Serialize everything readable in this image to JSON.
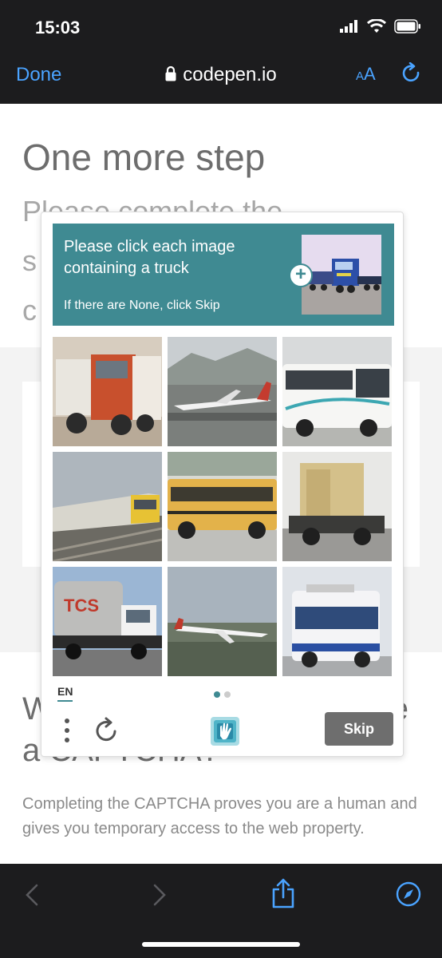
{
  "status_bar": {
    "time": "15:03"
  },
  "browser": {
    "done_label": "Done",
    "url": "codepen.io",
    "reader_label_small": "A",
    "reader_label_big": "A"
  },
  "page": {
    "heading": "One more step",
    "subheading": "Please complete the se... c...",
    "subheading_visible_line1": "Please complete the",
    "subheading_visible_line2_left": "s",
    "subheading_visible_line3_left": "c",
    "why_line1_left": "W",
    "why_line1_right": "e",
    "why_line2": "a CAPTCHA?",
    "description": "Completing the CAPTCHA proves you are a human and gives you temporary access to the web property."
  },
  "captcha": {
    "prompt_title": "Please click each image containing a truck",
    "prompt_sub": "If there are None, click Skip",
    "prompt_plus": "+",
    "language": "EN",
    "skip_label": "Skip",
    "page_indicator": {
      "current": 1,
      "total": 2
    },
    "tiles": [
      {
        "subject": "truck"
      },
      {
        "subject": "airplane"
      },
      {
        "subject": "bus"
      },
      {
        "subject": "train"
      },
      {
        "subject": "school-bus"
      },
      {
        "subject": "truck"
      },
      {
        "subject": "truck"
      },
      {
        "subject": "airplane"
      },
      {
        "subject": "bus"
      }
    ]
  },
  "colors": {
    "accent": "#3f8a92",
    "link": "#4aa3ff",
    "bar": "#1c1c1e"
  }
}
